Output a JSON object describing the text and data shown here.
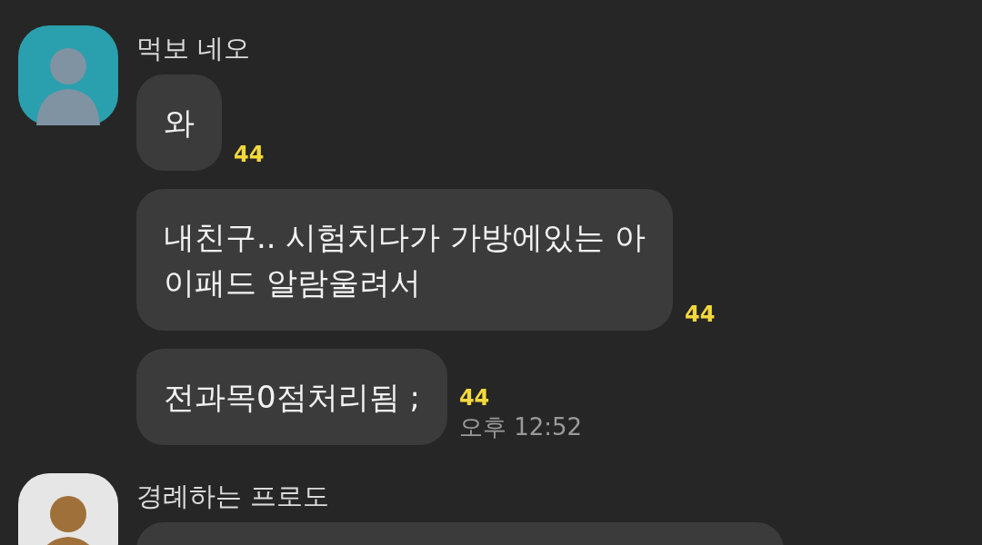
{
  "groups": [
    {
      "sender": "먹보 네오",
      "avatar": {
        "color": "#2a9fae"
      },
      "messages": [
        {
          "kind": "text",
          "lines": [
            "와"
          ],
          "unread": "44"
        },
        {
          "kind": "text",
          "lines": [
            "내친구.. 시험치다가 가방에있는 아",
            "이패드 알람울려서"
          ],
          "unread": "44"
        },
        {
          "kind": "text",
          "lines": [
            "전과목0점처리됨 ;"
          ],
          "unread": "44",
          "time": "오후 12:52"
        }
      ]
    },
    {
      "sender": "경례하는 프로도",
      "avatar": {
        "color": "#e6e6e6"
      },
      "messages": [
        {
          "kind": "cut"
        }
      ]
    }
  ]
}
